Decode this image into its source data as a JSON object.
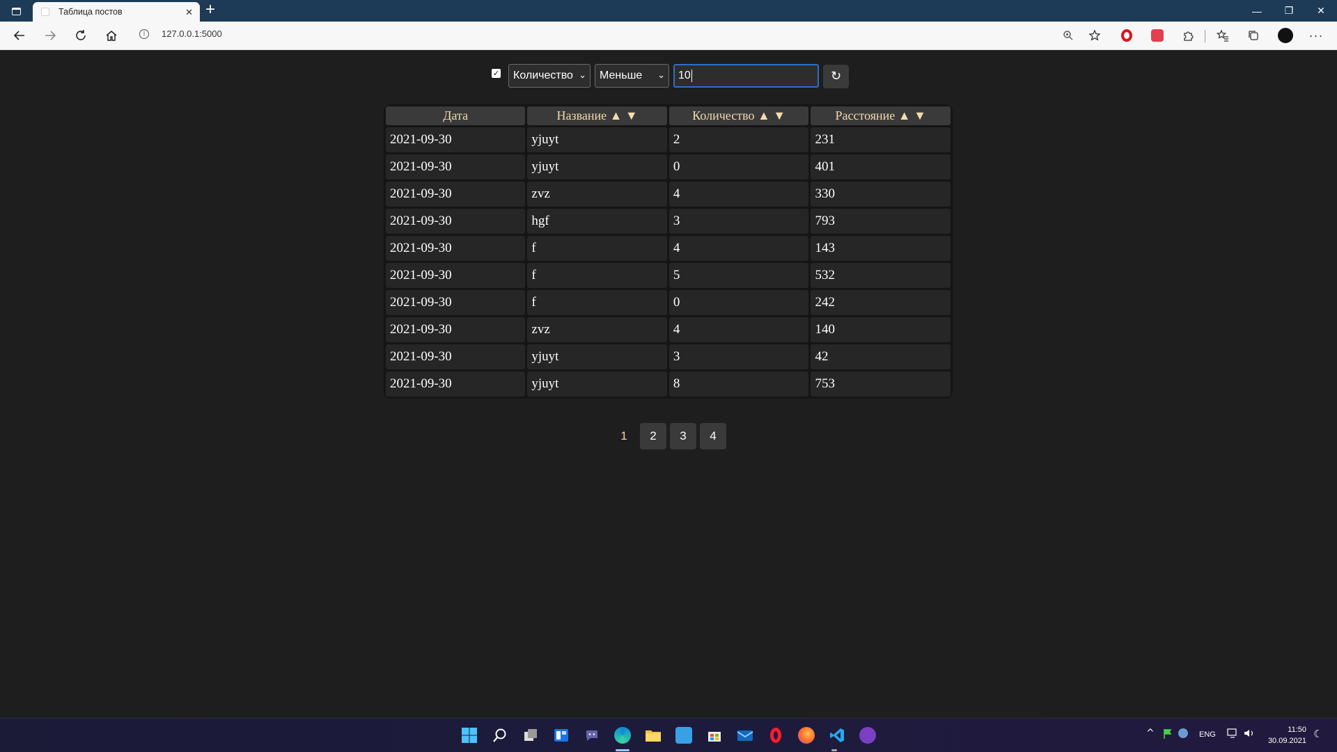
{
  "browser": {
    "tab_title": "Таблица постов",
    "tab_close": "✕",
    "new_tab": "+",
    "url": "127.0.0.1:5000",
    "window_controls": {
      "minimize": "—",
      "restore": "❐",
      "close": "✕"
    }
  },
  "filter": {
    "enabled_mark": "✓",
    "column_value": "Количество",
    "condition_value": "Меньше",
    "input_value": "10",
    "refresh_symbol": "↻"
  },
  "table": {
    "headers": [
      "Дата",
      "Название ▲ ▼",
      "Количество ▲ ▼",
      "Расстояние ▲ ▼"
    ],
    "rows": [
      [
        "2021-09-30",
        "yjuyt",
        "2",
        "231"
      ],
      [
        "2021-09-30",
        "yjuyt",
        "0",
        "401"
      ],
      [
        "2021-09-30",
        "zvz",
        "4",
        "330"
      ],
      [
        "2021-09-30",
        "hgf",
        "3",
        "793"
      ],
      [
        "2021-09-30",
        "f",
        "4",
        "143"
      ],
      [
        "2021-09-30",
        "f",
        "5",
        "532"
      ],
      [
        "2021-09-30",
        "f",
        "0",
        "242"
      ],
      [
        "2021-09-30",
        "zvz",
        "4",
        "140"
      ],
      [
        "2021-09-30",
        "yjuyt",
        "3",
        "42"
      ],
      [
        "2021-09-30",
        "yjuyt",
        "8",
        "753"
      ]
    ]
  },
  "pagination": {
    "pages": [
      "1",
      "2",
      "3",
      "4"
    ],
    "current": "1"
  },
  "taskbar": {
    "lang": "ENG",
    "time": "11:50",
    "date": "30.09.2021"
  },
  "colors": {
    "background": "#1e1e1e",
    "header_text": "#f3dcae",
    "accent_border": "#2f6dc9"
  }
}
